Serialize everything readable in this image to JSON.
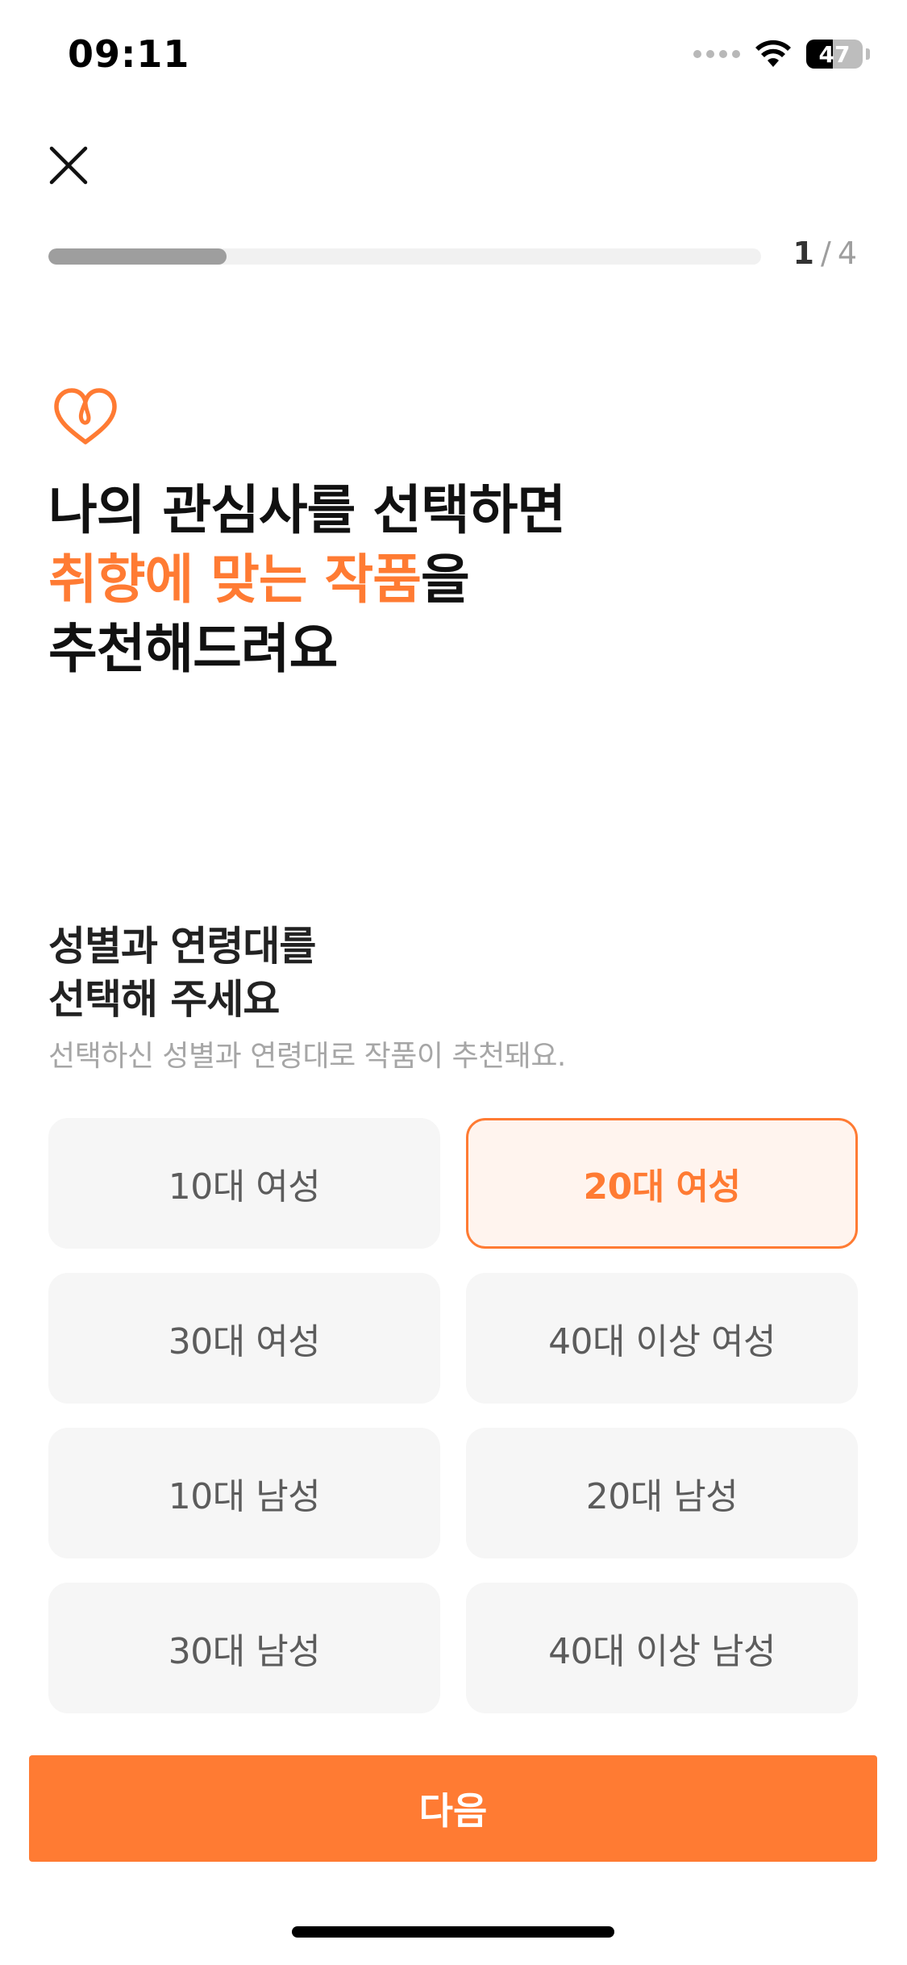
{
  "status_bar": {
    "time": "09:11",
    "battery": "47",
    "battery_level": 0.47
  },
  "header": {
    "close_icon": "close-icon"
  },
  "progress": {
    "current": "1",
    "separator": "/",
    "total": "4",
    "fraction": 0.25
  },
  "hero": {
    "icon": "heart-icon",
    "line1": "나의 관심사를 선택하면",
    "line2_accent": "취향에 맞는 작품",
    "line2_rest": "을",
    "line3": "추천해드려요"
  },
  "section": {
    "title_line1": "성별과 연령대를",
    "title_line2": "선택해 주세요",
    "subtitle": "선택하신 성별과 연령대로 작품이 추천돼요."
  },
  "options": [
    {
      "label": "10대 여성",
      "selected": false
    },
    {
      "label": "20대 여성",
      "selected": true
    },
    {
      "label": "30대 여성",
      "selected": false
    },
    {
      "label": "40대 이상 여성",
      "selected": false
    },
    {
      "label": "10대 남성",
      "selected": false
    },
    {
      "label": "20대 남성",
      "selected": false
    },
    {
      "label": "30대 남성",
      "selected": false
    },
    {
      "label": "40대 이상 남성",
      "selected": false
    }
  ],
  "footer": {
    "next_label": "다음"
  },
  "colors": {
    "accent": "#ff7b33",
    "selected_bg": "#fff4ee",
    "option_bg": "#f6f6f6"
  }
}
